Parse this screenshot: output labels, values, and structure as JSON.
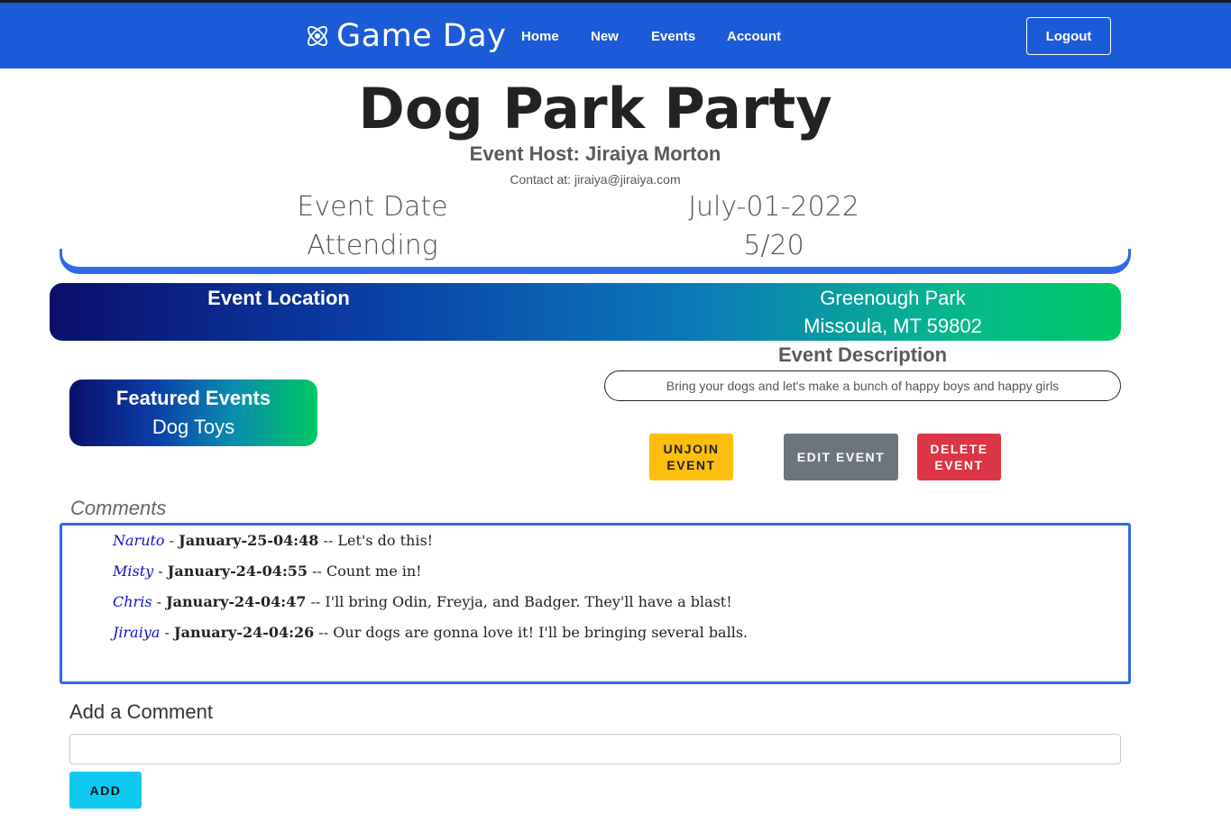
{
  "nav": {
    "brand": "Game Day",
    "brand_icon": "atom-icon",
    "links": [
      "Home",
      "New",
      "Events",
      "Account"
    ],
    "logout_label": "Logout"
  },
  "event": {
    "title": "Dog Park Party",
    "host": "Event Host: Jiraiya Morton",
    "contact": "Contact at: jiraiya@jiraiya.com",
    "date_label": "Event Date",
    "date_value": "July-01-2022",
    "attending_label": "Attending",
    "attending_value": "5/20",
    "location_label": "Event Location",
    "location_line1": "Greenough Park",
    "location_line2": "Missoula, MT 59802",
    "description_label": "Event Description",
    "description": "Bring your dogs and let's make a bunch of happy boys and happy girls"
  },
  "featured": {
    "title": "Featured Events",
    "item": "Dog Toys"
  },
  "actions": {
    "unjoin": "UNJOIN EVENT",
    "edit": "EDIT EVENT",
    "delete": "DELETE EVENT"
  },
  "comments": {
    "label": "Comments",
    "items": [
      {
        "user": "Naruto",
        "date": "January-25-04:48",
        "text": " -- Let's do this!"
      },
      {
        "user": "Misty",
        "date": "January-24-04:55",
        "text": " -- Count me in!"
      },
      {
        "user": "Chris",
        "date": "January-24-04:47",
        "text": " -- I'll bring Odin, Freyja, and Badger. They'll have a blast!"
      },
      {
        "user": "Jiraiya",
        "date": "January-24-04:26",
        "text": " -- Our dogs are gonna love it! I'll be bringing several balls."
      }
    ]
  },
  "add_comment": {
    "label": "Add a Comment",
    "input_value": "",
    "button": "ADD"
  },
  "colors": {
    "navbar": "#1b5bd8",
    "accent_blue": "#2f6be6",
    "unjoin": "#fdbe0e",
    "edit": "#6c757d",
    "delete": "#dc3545",
    "add": "#0fcaf0",
    "comment_user": "#0a14c8"
  }
}
